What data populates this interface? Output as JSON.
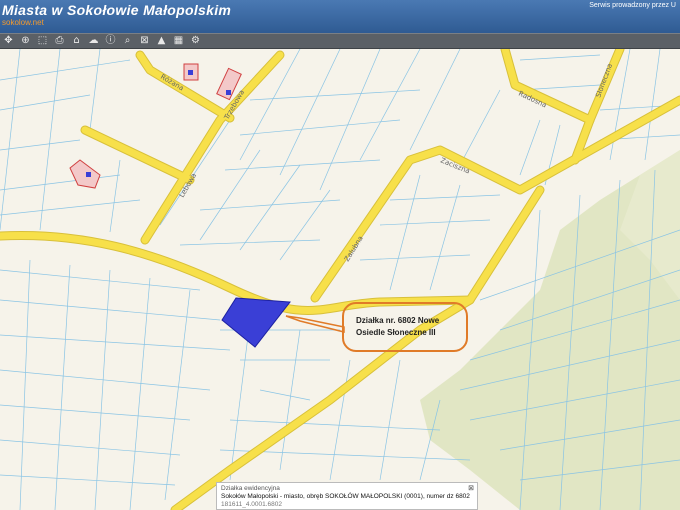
{
  "header": {
    "title": "Miasta w Sokołowie Małopolskim",
    "subtitle": "sokolow.net",
    "service_text": "Serwis prowadzony przez U"
  },
  "toolbar": {
    "tools": [
      {
        "icon": "pan-icon",
        "glyph": "✥"
      },
      {
        "icon": "zoom-in-icon",
        "glyph": "⊕"
      },
      {
        "icon": "select-icon",
        "glyph": "⬚"
      },
      {
        "icon": "print-icon",
        "glyph": "⎙"
      },
      {
        "icon": "home-icon",
        "glyph": "⌂"
      },
      {
        "icon": "layers-icon",
        "glyph": "☁"
      },
      {
        "icon": "info-icon",
        "glyph": "ⓘ"
      },
      {
        "icon": "search-icon",
        "glyph": "⌕"
      },
      {
        "icon": "measure-icon",
        "glyph": "⊠"
      },
      {
        "icon": "warning-icon",
        "glyph": "▲"
      },
      {
        "icon": "legend-icon",
        "glyph": "▦"
      },
      {
        "icon": "share-icon",
        "glyph": "⚙"
      }
    ]
  },
  "map": {
    "street_names": {
      "rozana": "Różana",
      "trzebowa": "Trzebowa",
      "lebowa": "Lebowa",
      "radosna": "Radosna",
      "sloneczna": "Słoneczna",
      "zaciszna": "Zaciszna",
      "zalubna": "Zalubna"
    },
    "colors": {
      "road": "#f7e04a",
      "road_edge": "#d8c03a",
      "parcel_line": "#8ac4e4",
      "highlight_parcel": "#3a3fd6",
      "forest": "#dfe4c0",
      "building": "#e05050",
      "callout_border": "#e07b28"
    }
  },
  "callout": {
    "line1": "Działka nr. 6802 Nowe",
    "line2": "Osiedle Słoneczne III"
  },
  "infobox": {
    "header": "Działka ewidencyjna",
    "body": "Sokołów Małopolski - miasto, obręb SOKOŁÓW MAŁOPOLSKI (0001), numer dz 6802",
    "id": "181611_4.0001.6802",
    "close": "⊠"
  }
}
